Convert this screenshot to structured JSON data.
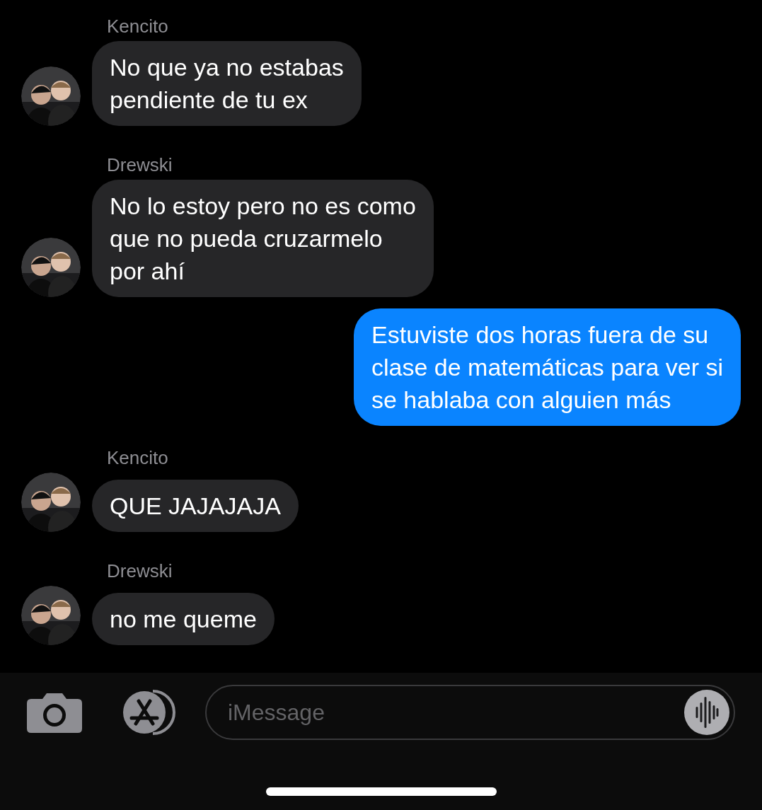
{
  "messages": [
    {
      "kind": "incoming",
      "sender": "Kencito",
      "text": "No que ya no estabas\npendiente de tu ex"
    },
    {
      "kind": "incoming",
      "sender": "Drewski",
      "text": "No lo estoy pero no es como\nque no pueda cruzarmelo\npor ahí"
    },
    {
      "kind": "outgoing",
      "text": "Estuviste dos horas fuera de su\nclase de matemáticas para ver si\nse hablaba con alguien más"
    },
    {
      "kind": "incoming",
      "sender": "Kencito",
      "text": "QUE JAJAJAJA"
    },
    {
      "kind": "incoming",
      "sender": "Drewski",
      "text": "no me queme"
    }
  ],
  "composer": {
    "placeholder": "iMessage"
  }
}
